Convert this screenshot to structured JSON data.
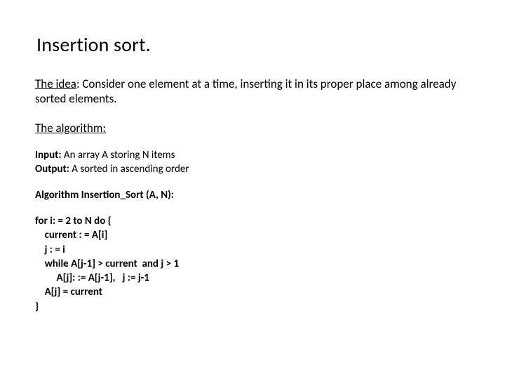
{
  "title": "Insertion sort.",
  "idea": {
    "label": "The idea",
    "text": ": Consider one element at a time, inserting it in its proper place among already sorted elements."
  },
  "algorithm_label": "The algorithm:",
  "io": {
    "input_label": "Input:",
    "input_text": " An array A storing N items",
    "output_label": "Output:",
    "output_text": " A sorted in ascending order"
  },
  "algo_name": "Algorithm Insertion_Sort (A, N):",
  "code": {
    "l1": "for i: = 2 to N do {",
    "l2": "    current : = A[i]",
    "l3": "    j : = i",
    "l4": "    while A[j-1] > current  and j > 1",
    "l5": "         A[j]: := A[j-1],   j := j-1",
    "l6": "    A[j] = current",
    "l7": "}"
  }
}
